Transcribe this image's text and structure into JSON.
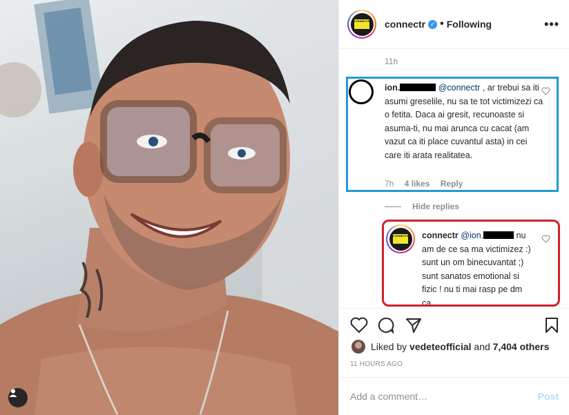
{
  "header": {
    "username": "connectr",
    "verified_icon": "verified-badge-icon",
    "separator": "•",
    "follow_status": "Following",
    "more_icon": "•••",
    "logo_text": "CONNECTR"
  },
  "comments": {
    "top_time": "11h",
    "first": {
      "username": "ion.",
      "mention": "@connectr",
      "text": " , ar trebui sa iti asumi greselile, nu sa te tot victimizezi ca o fetita. Daca ai gresit, recunoaste si asuma-ti, nu mai arunca cu cacat (am vazut ca iti place cuvantul asta) in cei care iti arata realitatea.",
      "time": "7h",
      "likes": "4 likes",
      "reply": "Reply"
    },
    "hide_replies": "Hide replies",
    "reply": {
      "username": "connectr",
      "mention": "@ion.",
      "text": " nu am de ce sa ma victimizez :) sunt un om binecuvantat ;) sunt sanatos emotional si fizic ! nu ti mai rasp pe dm ca"
    }
  },
  "liked_by": {
    "prefix": "Liked by ",
    "user": "vedeteofficial",
    "middle": " and ",
    "others": "7,404 others"
  },
  "timestamp": "11 HOURS AGO",
  "add_comment": {
    "placeholder": "Add a comment…",
    "post_label": "Post"
  },
  "colors": {
    "blue_highlight": "#1e9bd6",
    "red_highlight": "#d0202a",
    "mention": "#00376b",
    "muted": "#8e8e8e",
    "post_disabled": "#b2dffc"
  }
}
